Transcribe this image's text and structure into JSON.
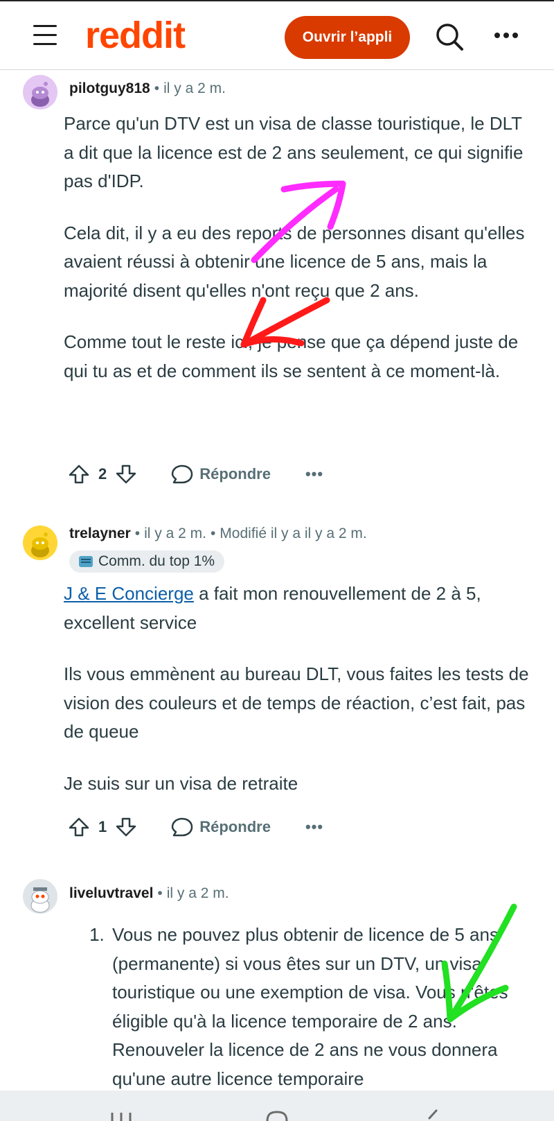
{
  "header": {
    "logo_text": "reddit",
    "open_app_label": "Ouvrir l’appli",
    "icons": [
      "menu-icon",
      "search-icon",
      "more-icon"
    ]
  },
  "comments": [
    {
      "username": "pilotguy818",
      "time": "il y a 2 m.",
      "paragraphs": [
        "Parce qu'un DTV est un visa de classe touristique, le DLT a dit que la licence est de 2 ans seulement, ce qui signifie pas d'IDP.",
        "Cela dit, il y a eu des reports de personnes disant qu'elles avaient réussi à obtenir une licence de 5 ans, mais la majorité disent qu'elles n'ont reçu que 2 ans.",
        "Comme tout le reste ici, je pense que ça dépend juste de qui tu as et de comment ils se sentent à ce moment-là."
      ],
      "votes": "2",
      "reply_label": "Répondre"
    },
    {
      "username": "trelayner",
      "time": "il y a 2 m.",
      "edited": "Modifié il y a il y a 2 m.",
      "flair": "Comm. du top 1%",
      "link_text": "J & E Concierge",
      "paragraphs": [
        " a fait mon renouvellement de 2 à 5, excellent service",
        "Ils vous emmènent au bureau DLT, vous faites les tests de vision des couleurs et de temps de réaction, c’est fait, pas de queue",
        "Je suis sur un visa de retraite"
      ],
      "votes": "1",
      "reply_label": "Répondre"
    },
    {
      "username": "liveluvtravel",
      "time": "il y a 2 m.",
      "list_items": [
        "Vous ne pouvez plus obtenir de licence de 5 ans (permanente) si vous êtes sur un DTV, un visa touristique ou une exemption de visa. Vous n'êtes éligible qu'à la licence temporaire de 2 ans. Renouveler la licence de 2 ans ne vous donnera qu'une autre licence temporaire"
      ]
    }
  ],
  "colors": {
    "brand": "#ff4500",
    "button": "#d93a00",
    "link": "#0b5ea8",
    "annotation_magenta": "#ff2bff",
    "annotation_red": "#ff1a1a",
    "annotation_green": "#22e022"
  }
}
